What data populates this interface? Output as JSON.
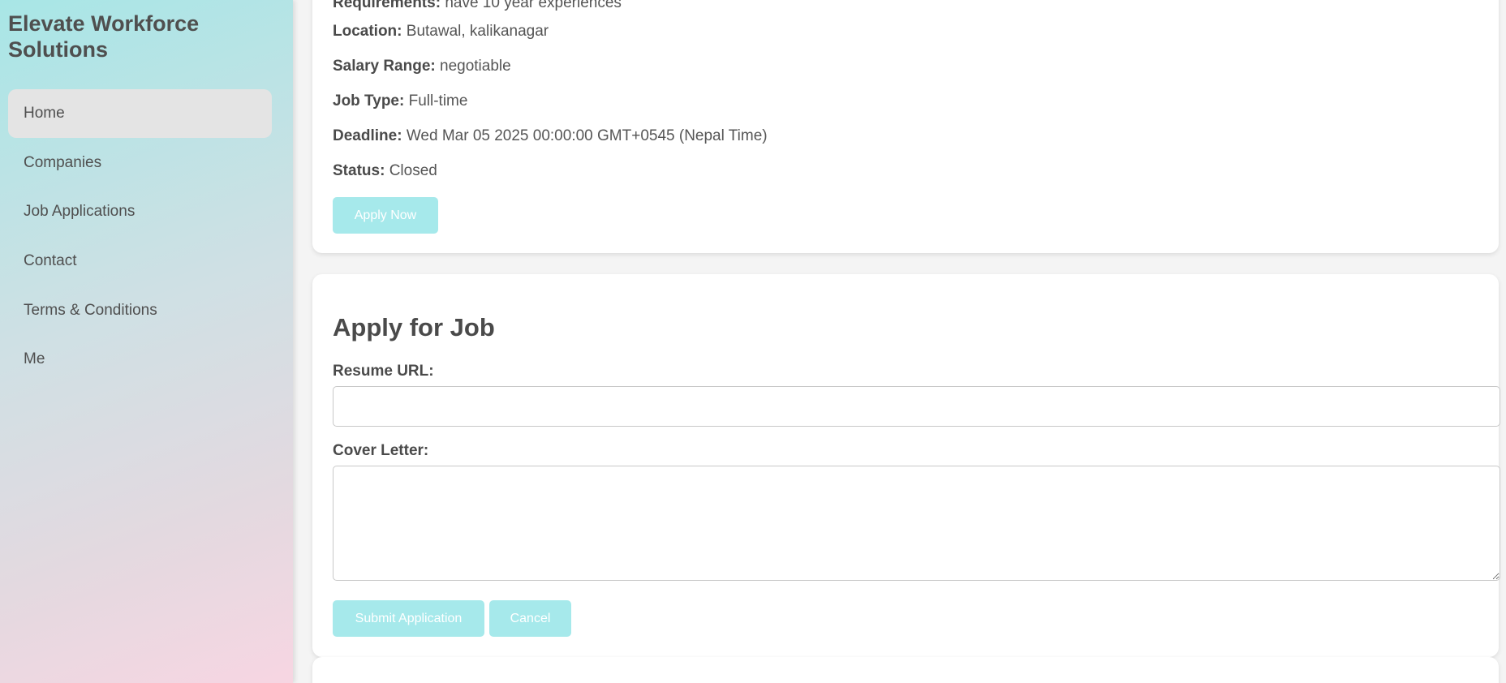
{
  "sidebar": {
    "brand": "Elevate Workforce Solutions",
    "items": [
      {
        "label": "Home",
        "active": true
      },
      {
        "label": "Companies"
      },
      {
        "label": "Job Applications"
      },
      {
        "label": "Contact"
      },
      {
        "label": "Terms & Conditions"
      },
      {
        "label": "Me"
      }
    ]
  },
  "job": {
    "requirements_label": "Requirements:",
    "requirements_value": "have 10 year experiences",
    "location_label": "Location:",
    "location_value": "Butawal, kalikanagar",
    "salary_label": "Salary Range:",
    "salary_value": "negotiable",
    "type_label": "Job Type:",
    "type_value": "Full-time",
    "deadline_label": "Deadline:",
    "deadline_value": "Wed Mar 05 2025 00:00:00 GMT+0545 (Nepal Time)",
    "status_label": "Status:",
    "status_value": "Closed",
    "apply_button": "Apply Now"
  },
  "apply_form": {
    "title": "Apply for Job",
    "resume_label": "Resume URL:",
    "resume_value": "",
    "cover_label": "Cover Letter:",
    "cover_value": "",
    "submit_button": "Submit Application",
    "cancel_button": "Cancel"
  },
  "colors": {
    "accent_button": "#a6e9eb",
    "active_nav": "#e4e4e4"
  }
}
